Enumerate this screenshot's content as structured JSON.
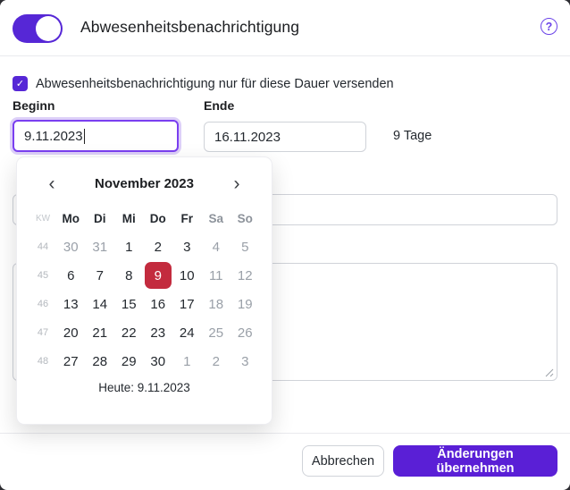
{
  "header": {
    "title": "Abwesenheitsbenachrichtigung",
    "toggle_state": "on",
    "help_icon": "?"
  },
  "duration": {
    "checkbox_checked": true,
    "check_icon": "✓",
    "label": "Abwesenheitsbenachrichtigung nur für diese Dauer versenden"
  },
  "fields": {
    "begin_label": "Beginn",
    "begin_value": "9.11.2023",
    "end_label": "Ende",
    "end_value": "16.11.2023",
    "days_text": "9 Tage"
  },
  "calendar": {
    "prev_icon": "‹",
    "next_icon": "›",
    "month_label": "November 2023",
    "col_headers": [
      "KW",
      "Mo",
      "Di",
      "Mi",
      "Do",
      "Fr",
      "Sa",
      "So"
    ],
    "weeks": [
      {
        "kw": "44",
        "days": [
          {
            "d": "30",
            "cls": "muted"
          },
          {
            "d": "31",
            "cls": "muted"
          },
          {
            "d": "1",
            "cls": ""
          },
          {
            "d": "2",
            "cls": ""
          },
          {
            "d": "3",
            "cls": ""
          },
          {
            "d": "4",
            "cls": "muted"
          },
          {
            "d": "5",
            "cls": "muted"
          }
        ]
      },
      {
        "kw": "45",
        "days": [
          {
            "d": "6",
            "cls": ""
          },
          {
            "d": "7",
            "cls": ""
          },
          {
            "d": "8",
            "cls": ""
          },
          {
            "d": "9",
            "cls": "selected"
          },
          {
            "d": "10",
            "cls": ""
          },
          {
            "d": "11",
            "cls": "muted"
          },
          {
            "d": "12",
            "cls": "muted"
          }
        ]
      },
      {
        "kw": "46",
        "days": [
          {
            "d": "13",
            "cls": ""
          },
          {
            "d": "14",
            "cls": ""
          },
          {
            "d": "15",
            "cls": ""
          },
          {
            "d": "16",
            "cls": ""
          },
          {
            "d": "17",
            "cls": ""
          },
          {
            "d": "18",
            "cls": "muted"
          },
          {
            "d": "19",
            "cls": "muted"
          }
        ]
      },
      {
        "kw": "47",
        "days": [
          {
            "d": "20",
            "cls": ""
          },
          {
            "d": "21",
            "cls": ""
          },
          {
            "d": "22",
            "cls": ""
          },
          {
            "d": "23",
            "cls": ""
          },
          {
            "d": "24",
            "cls": ""
          },
          {
            "d": "25",
            "cls": "muted"
          },
          {
            "d": "26",
            "cls": "muted"
          }
        ]
      },
      {
        "kw": "48",
        "days": [
          {
            "d": "27",
            "cls": ""
          },
          {
            "d": "28",
            "cls": ""
          },
          {
            "d": "29",
            "cls": ""
          },
          {
            "d": "30",
            "cls": ""
          },
          {
            "d": "1",
            "cls": "muted"
          },
          {
            "d": "2",
            "cls": "muted"
          },
          {
            "d": "3",
            "cls": "muted"
          }
        ]
      }
    ],
    "today_label": "Heute: 9.11.2023"
  },
  "footer": {
    "cancel_label": "Abbrechen",
    "submit_label": "Änderungen übernehmen"
  },
  "colors": {
    "accent_purple": "#5627d6",
    "submit_purple": "#5a1fd6",
    "selected_day_red": "#c32b3e",
    "focus_border": "#7a3ff0",
    "focus_ring": "#ddd0f8"
  }
}
